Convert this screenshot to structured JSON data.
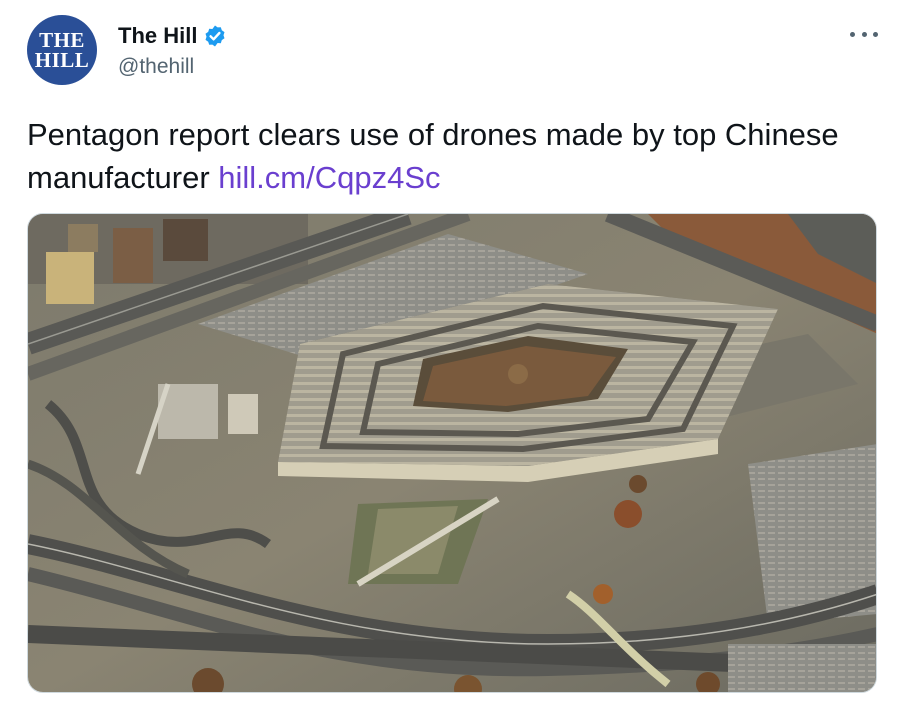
{
  "account": {
    "avatar_line1": "THE",
    "avatar_line2": "HILL",
    "display_name": "The Hill",
    "handle": "@thehill",
    "verified": true
  },
  "tweet": {
    "text": "Pentagon report clears use of drones made by top Chinese manufacturer",
    "link": "hill.cm/Cqpz4Sc"
  },
  "media": {
    "type": "image",
    "subject": "aerial-photo"
  },
  "icons": {
    "more": "more-options-icon",
    "verified": "verified-badge-icon"
  },
  "colors": {
    "link": "#6a3fcf",
    "verified": "#1d9bf0",
    "avatar_bg": "#2a4f97",
    "secondary_text": "#536471"
  }
}
